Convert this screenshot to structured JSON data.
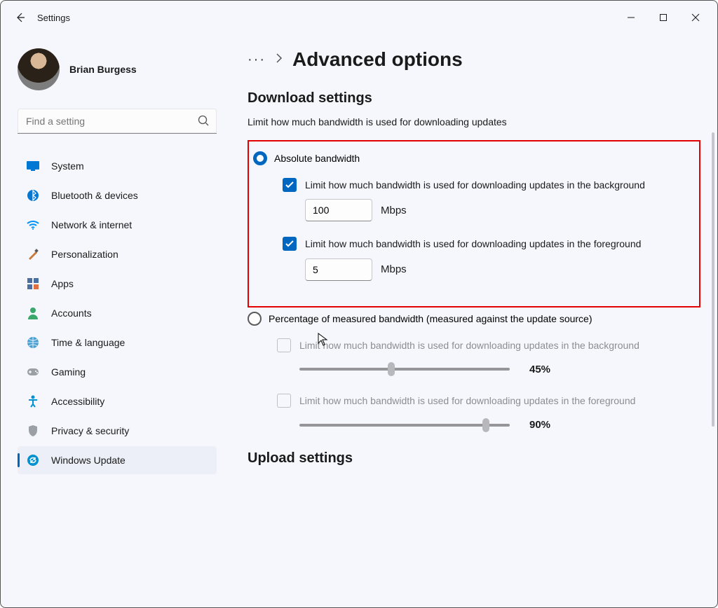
{
  "app_title": "Settings",
  "user": {
    "name": "Brian Burgess"
  },
  "search": {
    "placeholder": "Find a setting"
  },
  "nav": [
    {
      "label": "System",
      "icon": "monitor"
    },
    {
      "label": "Bluetooth & devices",
      "icon": "bluetooth"
    },
    {
      "label": "Network & internet",
      "icon": "wifi"
    },
    {
      "label": "Personalization",
      "icon": "brush"
    },
    {
      "label": "Apps",
      "icon": "apps"
    },
    {
      "label": "Accounts",
      "icon": "person"
    },
    {
      "label": "Time & language",
      "icon": "globe"
    },
    {
      "label": "Gaming",
      "icon": "gamepad"
    },
    {
      "label": "Accessibility",
      "icon": "accessibility"
    },
    {
      "label": "Privacy & security",
      "icon": "shield"
    },
    {
      "label": "Windows Update",
      "icon": "update",
      "selected": true
    }
  ],
  "breadcrumb": {
    "menu": "···",
    "chevron": "›",
    "title": "Advanced options"
  },
  "download": {
    "heading": "Download settings",
    "subline": "Limit how much bandwidth is used for downloading updates",
    "mode_absolute": {
      "label": "Absolute bandwidth",
      "bg": {
        "label": "Limit how much bandwidth is used for downloading updates in the background",
        "value": "100",
        "unit": "Mbps"
      },
      "fg": {
        "label": "Limit how much bandwidth is used for downloading updates in the foreground",
        "value": "5",
        "unit": "Mbps"
      }
    },
    "mode_percent": {
      "label": "Percentage of measured bandwidth (measured against the update source)",
      "bg": {
        "label": "Limit how much bandwidth is used for downloading updates in the background",
        "pct": "45%",
        "pos": 42
      },
      "fg": {
        "label": "Limit how much bandwidth is used for downloading updates in the foreground",
        "pct": "90%",
        "pos": 87
      }
    }
  },
  "upload": {
    "heading": "Upload settings"
  }
}
